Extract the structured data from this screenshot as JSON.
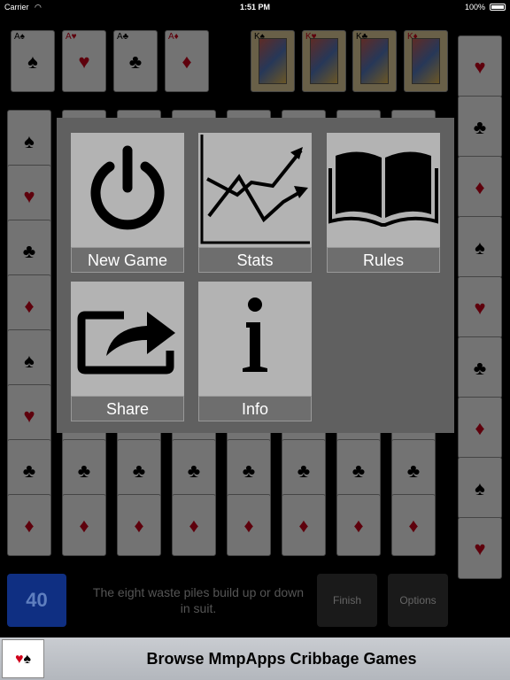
{
  "status_bar": {
    "carrier": "Carrier",
    "time": "1:51 PM",
    "battery": "100%"
  },
  "background_cards": [
    {
      "rank": "A",
      "suit": "♠",
      "color": "blk",
      "face": false
    },
    {
      "rank": "A",
      "suit": "♥",
      "color": "red",
      "face": false
    },
    {
      "rank": "A",
      "suit": "♣",
      "color": "blk",
      "face": false
    },
    {
      "rank": "A",
      "suit": "♦",
      "color": "red",
      "face": false
    },
    {
      "rank": "K",
      "suit": "♠",
      "color": "blk",
      "face": true
    },
    {
      "rank": "K",
      "suit": "♥",
      "color": "red",
      "face": true
    },
    {
      "rank": "K",
      "suit": "♣",
      "color": "blk",
      "face": true
    },
    {
      "rank": "K",
      "suit": "♦",
      "color": "red",
      "face": true
    }
  ],
  "menu": {
    "new_game": "New Game",
    "stats": "Stats",
    "rules": "Rules",
    "share": "Share",
    "info": "Info"
  },
  "bottom": {
    "score": "40",
    "hint": "The eight waste piles build up or down in suit.",
    "finish": "Finish",
    "options": "Options"
  },
  "banner": {
    "text": "Browse MmpApps Cribbage Games"
  }
}
